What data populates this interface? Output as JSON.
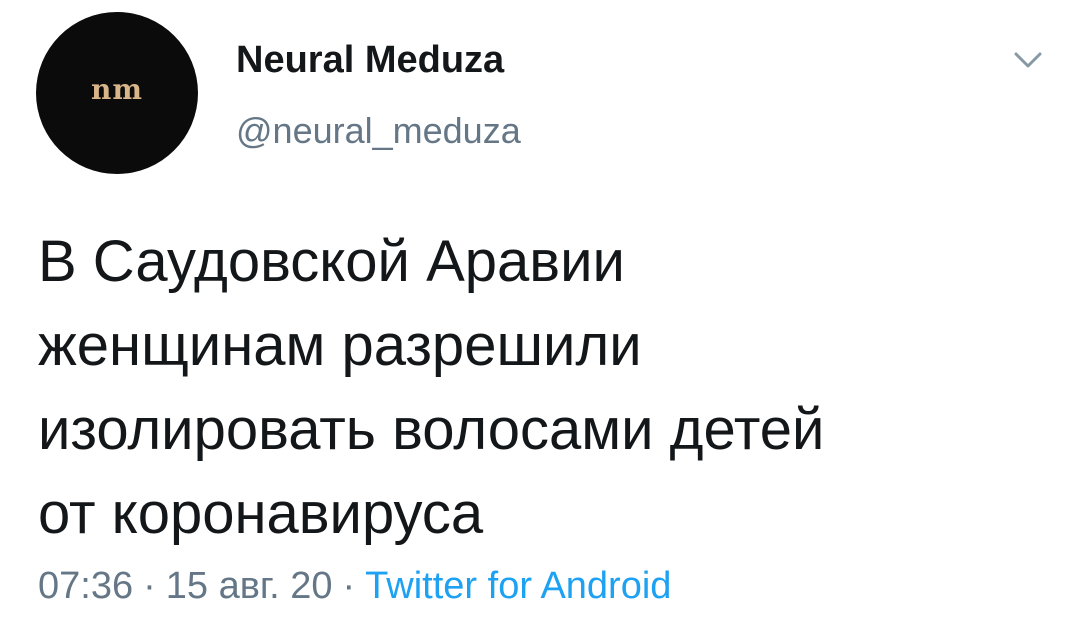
{
  "tweet": {
    "author": {
      "display_name": "Neural Meduza",
      "handle": "@neural_meduza",
      "avatar_text": "nm"
    },
    "menu_icon": "chevron-down-icon",
    "text": "В Саудовской Аравии\nженщинам разрешили\nизолировать волосами детей\nот коронавируса",
    "time": "07:36",
    "date": "15 авг. 20",
    "separator": "·",
    "source": "Twitter for Android"
  },
  "colors": {
    "text_primary": "#14171a",
    "text_secondary": "#657786",
    "link": "#1da1f2",
    "avatar_bg": "#0b0b0b",
    "avatar_text": "#d9b58a"
  }
}
